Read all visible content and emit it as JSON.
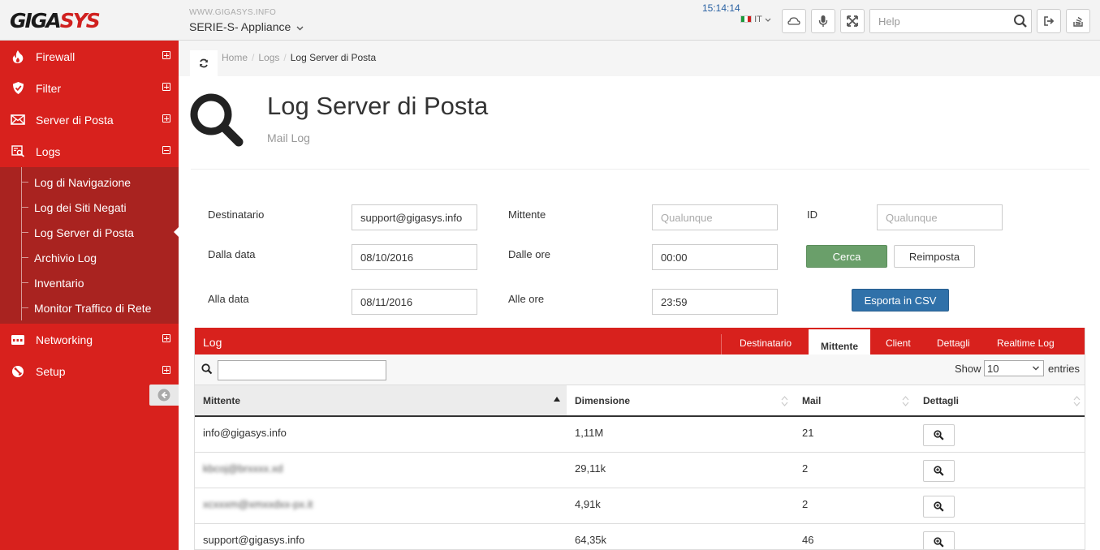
{
  "header": {
    "logo": {
      "part1": "GIGA",
      "part2": "SYS"
    },
    "site_url": "WWW.GIGASYS.INFO",
    "appliance": "SERIE-S- Appliance",
    "clock": "15:14:14",
    "language": "IT",
    "help_placeholder": "Help"
  },
  "sidebar": {
    "items": [
      {
        "label": "Firewall",
        "icon": "flame-icon"
      },
      {
        "label": "Filter",
        "icon": "shield-icon"
      },
      {
        "label": "Server di Posta",
        "icon": "envelope-icon"
      },
      {
        "label": "Logs",
        "icon": "log-search-icon"
      },
      {
        "label": "Networking",
        "icon": "network-switch-icon"
      },
      {
        "label": "Setup",
        "icon": "setup-icon"
      }
    ],
    "logs_submenu": [
      "Log di Navigazione",
      "Log dei Siti Negati",
      "Log Server di Posta",
      "Archivio Log",
      "Inventario",
      "Monitor Traffico di Rete"
    ]
  },
  "breadcrumb": {
    "home": "Home",
    "logs": "Logs",
    "current": "Log Server di Posta"
  },
  "page": {
    "title": "Log Server di Posta",
    "subtitle": "Mail Log"
  },
  "form": {
    "destinatario_label": "Destinatario",
    "destinatario_value": "support@gigasys.info",
    "mittente_label": "Mittente",
    "mittente_placeholder": "Qualunque",
    "id_label": "ID",
    "id_placeholder": "Qualunque",
    "dalla_data_label": "Dalla data",
    "dalla_data_value": "08/10/2016",
    "dalle_ore_label": "Dalle ore",
    "dalle_ore_value": "00:00",
    "alla_data_label": "Alla data",
    "alla_data_value": "08/11/2016",
    "alle_ore_label": "Alle ore",
    "alle_ore_value": "23:59",
    "cerca": "Cerca",
    "reimposta": "Reimposta",
    "esporta": "Esporta in CSV"
  },
  "log_panel": {
    "title": "Log",
    "tabs": [
      "Destinatario",
      "Mittente",
      "Client",
      "Dettagli",
      "Realtime Log"
    ],
    "active_tab": "Mittente",
    "show_label": "Show",
    "show_value": "10",
    "entries_label": "entries",
    "columns": [
      "Mittente",
      "Dimensione",
      "Mail",
      "Dettagli"
    ],
    "rows": [
      {
        "mittente": "info@gigasys.info",
        "dimensione": "1,11M",
        "mail": "21",
        "blurred": false
      },
      {
        "mittente": "kbcoj@brxxxx.xd",
        "dimensione": "29,11k",
        "mail": "2",
        "blurred": true
      },
      {
        "mittente": "xcxxxm@xmxxdxx-px.it",
        "dimensione": "4,91k",
        "mail": "2",
        "blurred": true
      },
      {
        "mittente": "support@gigasys.info",
        "dimensione": "64,35k",
        "mail": "46",
        "blurred": false
      }
    ]
  },
  "colors": {
    "brand_red": "#d8211d",
    "submenu_red": "#a92320",
    "cerca_green": "#6a9f6a",
    "csv_blue": "#3071a9",
    "clock_blue": "#2a62a3"
  }
}
